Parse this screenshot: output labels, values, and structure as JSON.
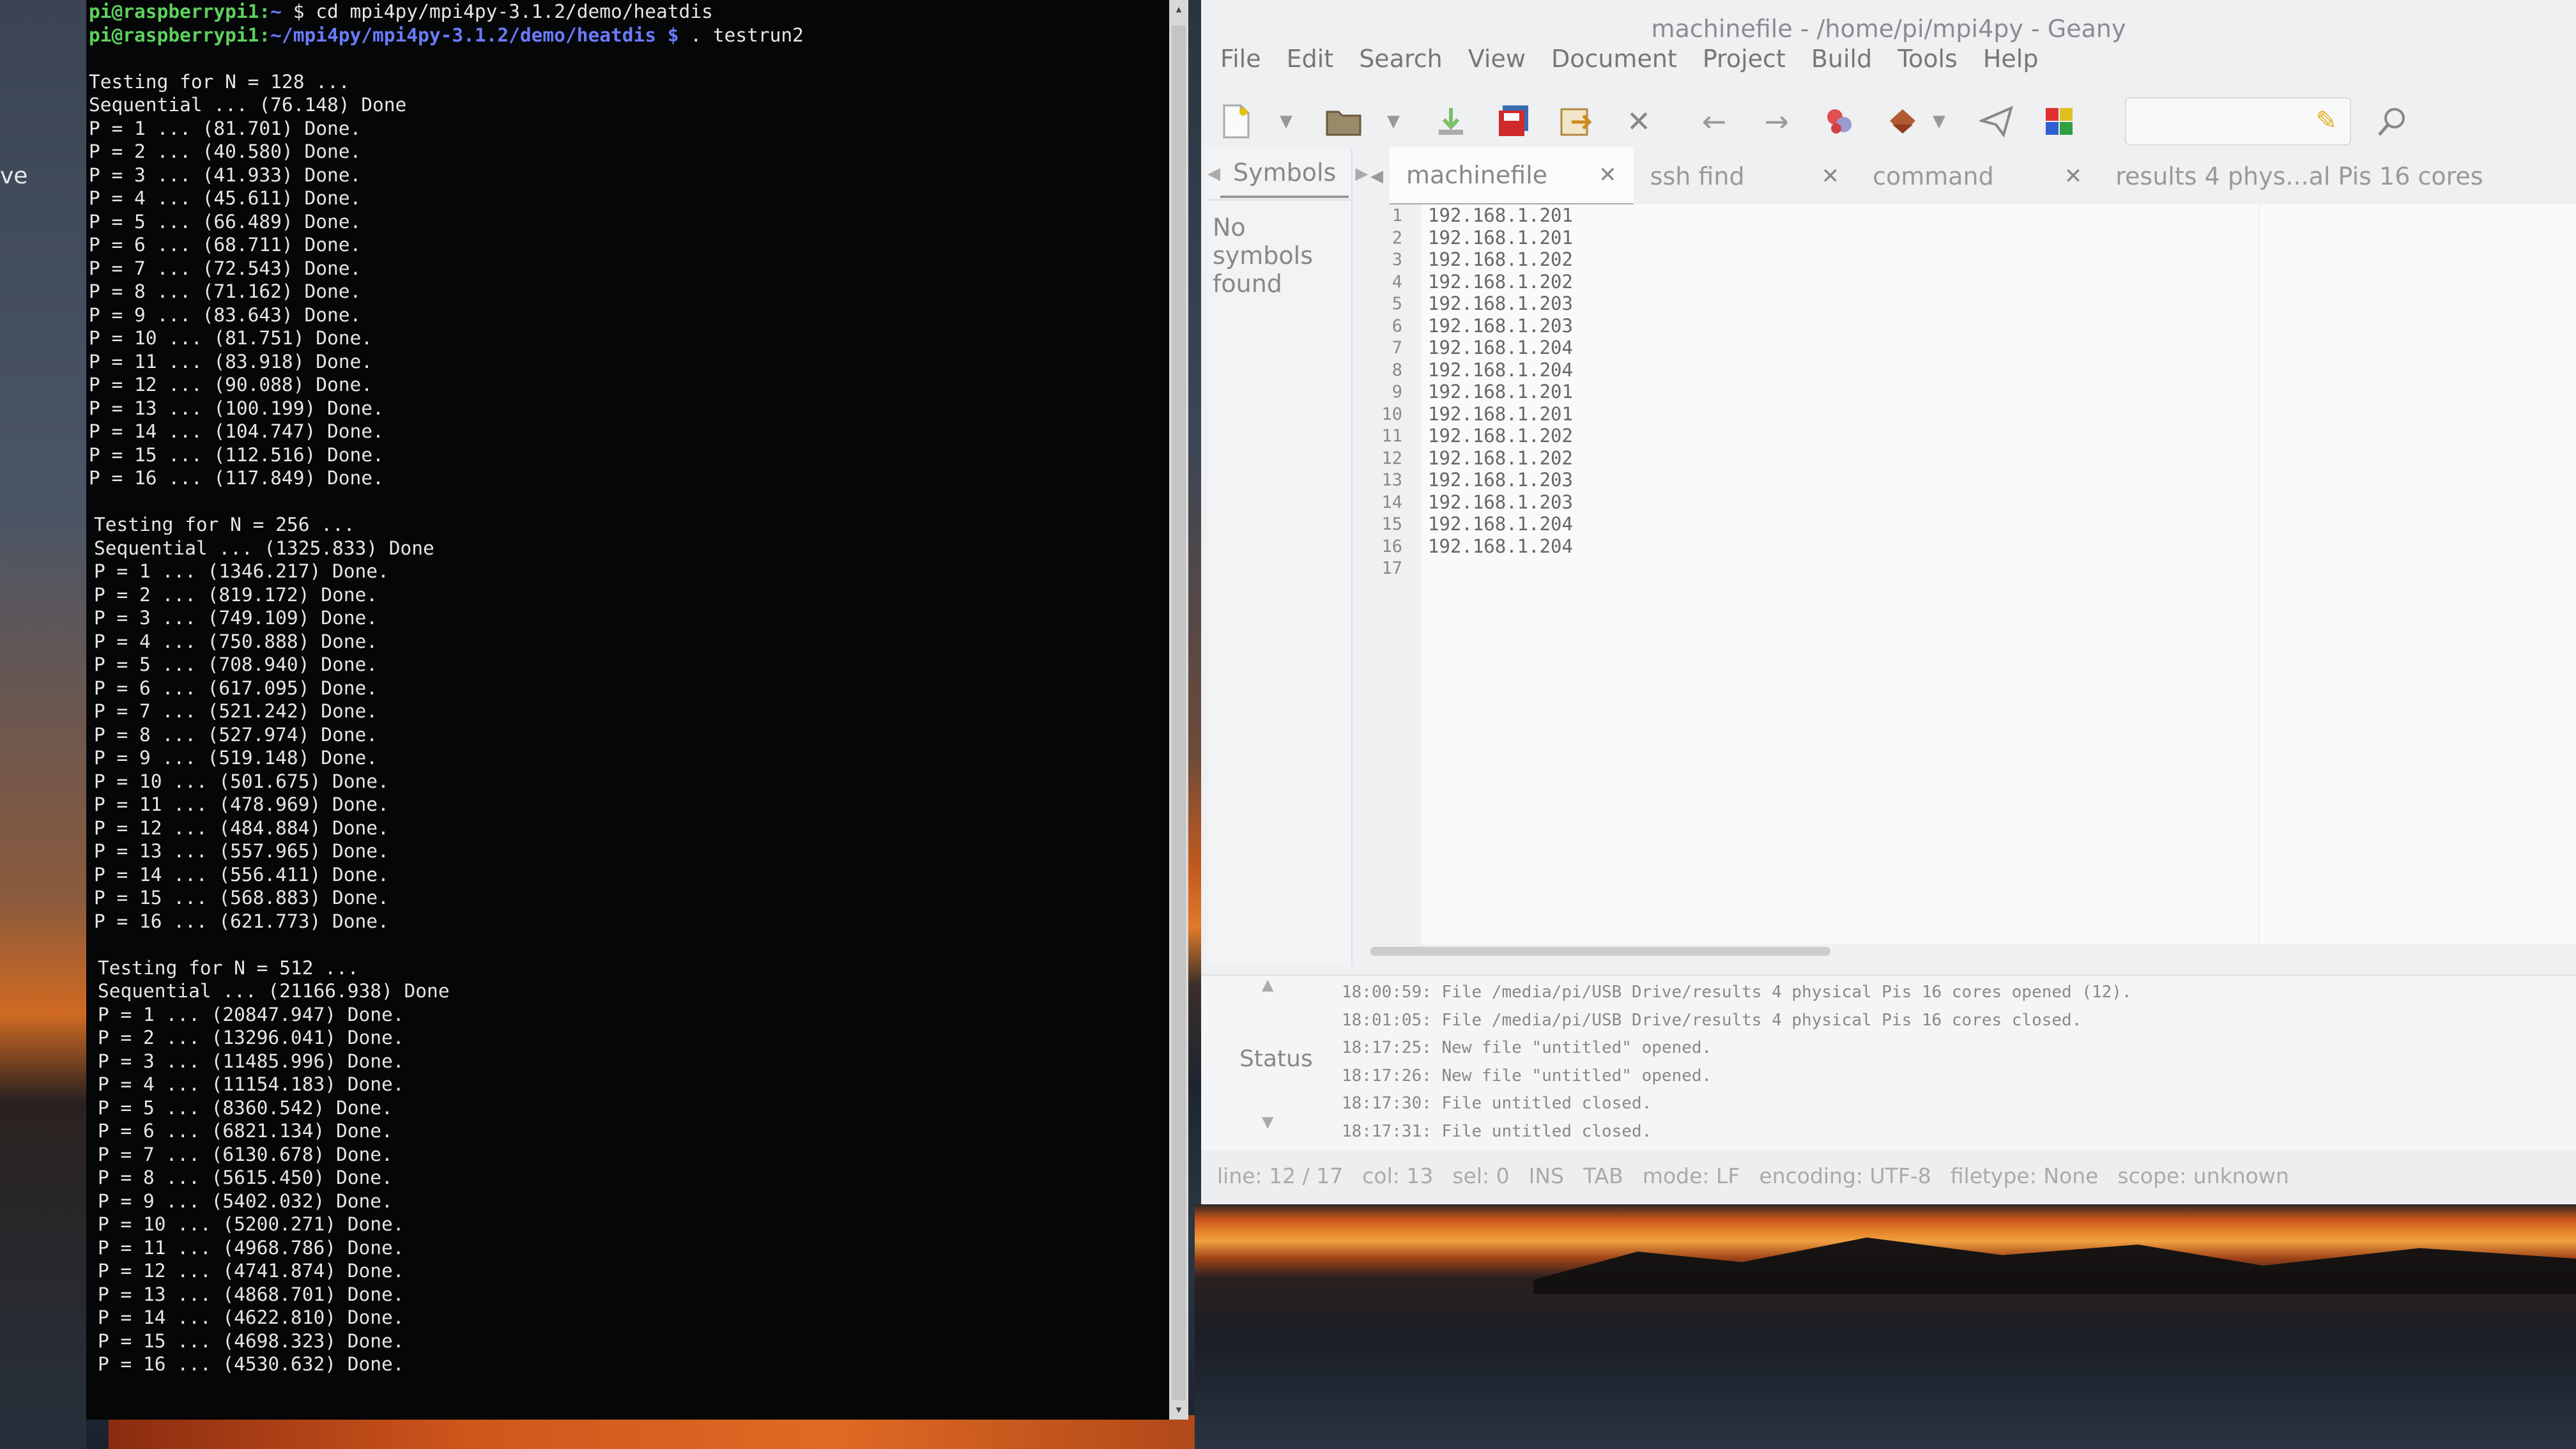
{
  "desktop": {
    "label": "ve"
  },
  "terminal": {
    "lines": [
      {
        "user": "pi@raspberrypi1:",
        "path": "~",
        "cmd": " $ cd mpi4py/mpi4py-3.1.2/demo/heatdis"
      },
      {
        "user": "pi@raspberrypi1:",
        "path": "~/mpi4py/mpi4py-3.1.2/demo/heatdis $",
        "cmd": " . testrun2"
      },
      {
        "text": ""
      },
      {
        "text": "Testing for N = 128 ..."
      },
      {
        "text": "Sequential ... (76.148) Done"
      },
      {
        "text": "P = 1 ... (81.701) Done."
      },
      {
        "text": "P = 2 ... (40.580) Done."
      },
      {
        "text": "P = 3 ... (41.933) Done."
      },
      {
        "text": "P = 4 ... (45.611) Done."
      },
      {
        "text": "P = 5 ... (66.489) Done."
      },
      {
        "text": "P = 6 ... (68.711) Done."
      },
      {
        "text": "P = 7 ... (72.543) Done."
      },
      {
        "text": "P = 8 ... (71.162) Done."
      },
      {
        "text": "P = 9 ... (83.643) Done."
      },
      {
        "text": "P = 10 ... (81.751) Done."
      },
      {
        "text": "P = 11 ... (83.918) Done."
      },
      {
        "text": "P = 12 ... (90.088) Done."
      },
      {
        "text": "P = 13 ... (100.199) Done."
      },
      {
        "text": "P = 14 ... (104.747) Done."
      },
      {
        "text": "P = 15 ... (112.516) Done."
      },
      {
        "text": "P = 16 ... (117.849) Done."
      },
      {
        "text": ""
      },
      {
        "text": "Testing for N = 256 ..."
      },
      {
        "text": "Sequential ... (1325.833) Done"
      },
      {
        "text": "P = 1 ... (1346.217) Done."
      },
      {
        "text": "P = 2 ... (819.172) Done."
      },
      {
        "text": "P = 3 ... (749.109) Done."
      },
      {
        "text": "P = 4 ... (750.888) Done."
      },
      {
        "text": "P = 5 ... (708.940) Done."
      },
      {
        "text": "P = 6 ... (617.095) Done."
      },
      {
        "text": "P = 7 ... (521.242) Done."
      },
      {
        "text": "P = 8 ... (527.974) Done."
      },
      {
        "text": "P = 9 ... (519.148) Done."
      },
      {
        "text": "P = 10 ... (501.675) Done."
      },
      {
        "text": "P = 11 ... (478.969) Done."
      },
      {
        "text": "P = 12 ... (484.884) Done."
      },
      {
        "text": "P = 13 ... (557.965) Done."
      },
      {
        "text": "P = 14 ... (556.411) Done."
      },
      {
        "text": "P = 15 ... (568.883) Done."
      },
      {
        "text": "P = 16 ... (621.773) Done."
      },
      {
        "text": ""
      },
      {
        "text": "Testing for N = 512 ..."
      },
      {
        "text": "Sequential ... (21166.938) Done"
      },
      {
        "text": "P = 1 ... (20847.947) Done."
      },
      {
        "text": "P = 2 ... (13296.041) Done."
      },
      {
        "text": "P = 3 ... (11485.996) Done."
      },
      {
        "text": "P = 4 ... (11154.183) Done."
      },
      {
        "text": "P = 5 ... (8360.542) Done."
      },
      {
        "text": "P = 6 ... (6821.134) Done."
      },
      {
        "text": "P = 7 ... (6130.678) Done."
      },
      {
        "text": "P = 8 ... (5615.450) Done."
      },
      {
        "text": "P = 9 ... (5402.032) Done."
      },
      {
        "text": "P = 10 ... (5200.271) Done."
      },
      {
        "text": "P = 11 ... (4968.786) Done."
      },
      {
        "text": "P = 12 ... (4741.874) Done."
      },
      {
        "text": "P = 13 ... (4868.701) Done."
      },
      {
        "text": "P = 14 ... (4622.810) Done."
      },
      {
        "text": "P = 15 ... (4698.323) Done."
      },
      {
        "text": "P = 16 ... (4530.632) Done."
      }
    ]
  },
  "geany": {
    "title": "machinefile - /home/pi/mpi4py - Geany",
    "menu": [
      "File",
      "Edit",
      "Search",
      "View",
      "Document",
      "Project",
      "Build",
      "Tools",
      "Help"
    ],
    "toolbar_icons": [
      "new-file-icon",
      "dropdown-icon",
      "open-folder-icon",
      "dropdown-icon",
      "save-icon",
      "save-all-icon",
      "revert-icon",
      "close-file-icon",
      "back-icon",
      "forward-icon",
      "compile-icon",
      "build-icon",
      "dropdown-icon",
      "run-icon",
      "color-chooser-icon"
    ],
    "search_placeholder": "",
    "sidebar": {
      "tab": "Symbols",
      "empty_text": "No symbols found"
    },
    "tabs": [
      {
        "label": "machinefile",
        "active": true
      },
      {
        "label": "ssh find",
        "active": false
      },
      {
        "label": "command",
        "active": false
      },
      {
        "label": "results 4 phys...al Pis 16 cores",
        "active": false
      }
    ],
    "editor_lines": [
      "192.168.1.201",
      "192.168.1.201",
      "192.168.1.202",
      "192.168.1.202",
      "192.168.1.203",
      "192.168.1.203",
      "192.168.1.204",
      "192.168.1.204",
      "192.168.1.201",
      "192.168.1.201",
      "192.168.1.202",
      "192.168.1.202",
      "192.168.1.203",
      "192.168.1.203",
      "192.168.1.204",
      "192.168.1.204",
      ""
    ],
    "messages_label": "Status",
    "messages": [
      "18:00:59: File /media/pi/USB Drive/results 4 physical Pis 16 cores opened (12).",
      "18:01:05: File /media/pi/USB Drive/results 4 physical Pis 16 cores closed.",
      "18:17:25: New file \"untitled\" opened.",
      "18:17:26: New file \"untitled\" opened.",
      "18:17:30: File untitled closed.",
      "18:17:31: File untitled closed."
    ],
    "statusbar": [
      "line: 12 / 17",
      "col: 13",
      "sel: 0",
      "INS",
      "TAB",
      "mode: LF",
      "encoding: UTF-8",
      "filetype: None",
      "scope: unknown"
    ]
  }
}
